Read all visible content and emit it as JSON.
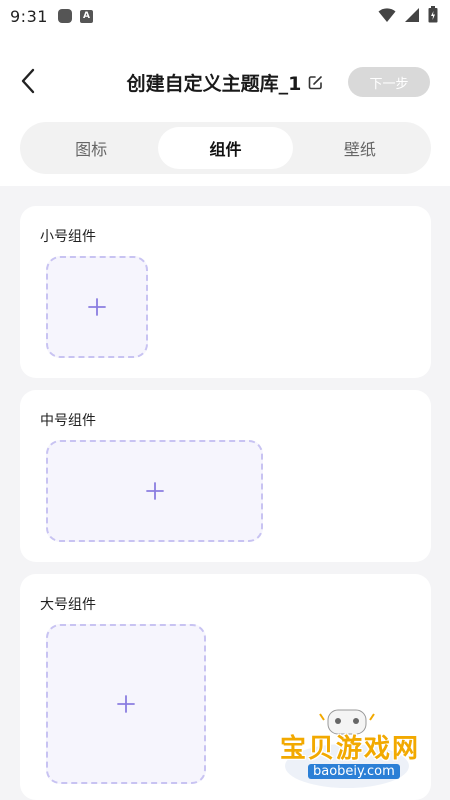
{
  "status": {
    "time": "9:31",
    "a_badge": "A"
  },
  "header": {
    "title": "创建自定义主题库_1",
    "next_label": "下一步"
  },
  "tabs": [
    {
      "label": "图标"
    },
    {
      "label": "组件"
    },
    {
      "label": "壁纸"
    }
  ],
  "active_tab": "组件",
  "sections": [
    {
      "title": "小号组件",
      "slot_icon": "plus-icon"
    },
    {
      "title": "中号组件",
      "slot_icon": "plus-icon"
    },
    {
      "title": "大号组件",
      "slot_icon": "plus-icon"
    }
  ],
  "watermark": {
    "text": "宝贝游戏网",
    "url": "baobeiy.com"
  },
  "colors": {
    "accent": "#8a7de0",
    "slot_border": "#c8c3f2",
    "slot_fill": "#f6f5fd",
    "next_button_bg": "#d9d9d9",
    "tab_bar_bg": "#f2f2f2",
    "content_bg": "#f4f4f6"
  }
}
